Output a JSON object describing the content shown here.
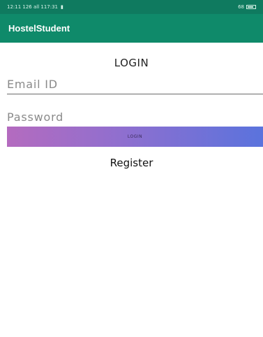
{
  "status_bar": {
    "left_text": "12:11 126 all 117:31",
    "right_text": "68"
  },
  "app_bar": {
    "title": "HostelStudent"
  },
  "form": {
    "heading": "LOGIN",
    "email_placeholder": "Email ID",
    "email_value": "",
    "password_placeholder": "Password",
    "password_value": "",
    "login_button_label": "LOGIN",
    "register_label": "Register"
  },
  "colors": {
    "status_bar": "#0f7a5f",
    "app_bar": "#0f8a6a",
    "button_gradient_start": "#b46bbf",
    "button_gradient_end": "#5a73dd"
  }
}
